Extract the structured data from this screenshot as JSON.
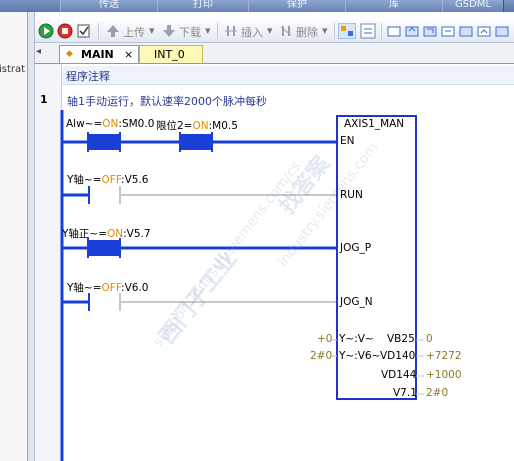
{
  "menu": {
    "tabs": [
      "传送",
      "打印",
      "保护",
      "库",
      "GSDML"
    ]
  },
  "left_pane": {
    "partial_text": "istrat"
  },
  "toolbar": {
    "upload_label": "上传",
    "download_label": "下载",
    "insert_label": "插入",
    "delete_label": "删除"
  },
  "tabs": [
    {
      "label": "MAIN",
      "close": "×"
    },
    {
      "label": "INT_0"
    }
  ],
  "editor": {
    "program_comment": "程序注释",
    "network": {
      "number": "1",
      "comment": "轴1手动运行，默认速率2000个脉冲每秒",
      "contacts": [
        {
          "prefix": "Alw~=",
          "state": "ON",
          "address": ":SM0.0"
        },
        {
          "prefix": "限位2=",
          "state": "ON",
          "address": ":M0.5"
        },
        {
          "prefix": "Y轴~=",
          "state": "OFF",
          "address": ":V5.6"
        },
        {
          "prefix": "Y轴正~=",
          "state": "ON",
          "address": ":V5.7"
        },
        {
          "prefix": "Y轴~=",
          "state": "OFF",
          "address": ":V6.0"
        }
      ],
      "block": {
        "title": "AXIS1_MAN",
        "inputs": [
          "EN",
          "RUN",
          "JOG_P",
          "JOG_N"
        ],
        "param_rows": [
          {
            "in_value": "+0",
            "in_name": "Y~:V~",
            "out_name": "VB25",
            "out_value": "0"
          },
          {
            "in_value": "2#0",
            "in_name": "Y~:V6~",
            "out_name": "VD140",
            "out_value": "+7272"
          },
          {
            "in_value": "",
            "in_name": "",
            "out_name": "VD144",
            "out_value": "+1000"
          },
          {
            "in_value": "",
            "in_name": "",
            "out_name": "V7.1",
            "out_value": "2#0"
          }
        ]
      }
    }
  },
  "watermark": {
    "big": "西门子工业",
    "small": "support.industry.siemens.com/cs",
    "big2": "找答案",
    "small2": "industry.siemens.com"
  },
  "colors": {
    "on_contact": "#1a3fd6",
    "rung_energized": "#1a3fd6",
    "rung_idle": "#c8c8c8",
    "block_border": "#2233cc",
    "state_text": "#e08e00"
  }
}
